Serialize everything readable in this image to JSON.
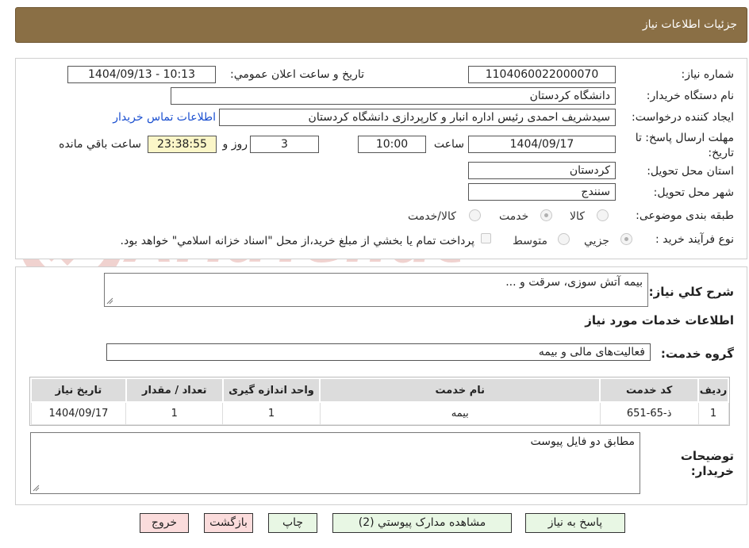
{
  "header": {
    "title": "جزئیات اطلاعات نیاز"
  },
  "form": {
    "need_number_label": "شماره نیاز:",
    "need_number": "1104060022000070",
    "announce_label": "تاریخ و ساعت اعلان عمومي:",
    "announce_value": "1404/09/13 - 10:13",
    "buyer_org_label": "نام دستگاه خريدار:",
    "buyer_org": "دانشگاه کردستان",
    "creator_label": "ايجاد کننده درخواست:",
    "creator": "سيدشريف احمدی رئيس اداره انبار و کارپردازی دانشگاه کردستان",
    "contact_link": "اطلاعات تماس خريدار",
    "deadline_label": "مهلت ارسال پاسخ: تا تاریخ:",
    "deadline_date": "1404/09/17",
    "time_label": "ساعت",
    "deadline_time": "10:00",
    "days": "3",
    "days_label": "روز و",
    "remaining": "23:38:55",
    "remaining_label": "ساعت باقي مانده",
    "province_label": "استان محل تحويل:",
    "province": "کردستان",
    "city_label": "شهر محل تحويل:",
    "city": "سنندج",
    "category_label": "طبقه بندی موضوعی:",
    "category_options": [
      "کالا",
      "خدمت",
      "کالا/خدمت"
    ],
    "category_selected": "خدمت",
    "process_label": "نوع فرآيند خريد :",
    "process_options": [
      "جزيي",
      "متوسط"
    ],
    "process_selected": "جزيي",
    "payment_note": "پرداخت تمام يا بخشي از مبلغ خريد،از محل \"اسناد خزانه اسلامي\" خواهد بود."
  },
  "description": {
    "summary_label": "شرح کلي نياز:",
    "summary": "بیمه آتش سوزی، سرقت و ...",
    "services_title": "اطلاعات خدمات مورد نياز",
    "service_group_label": "گروه خدمت:",
    "service_group": "فعاليت‌های مالی و بيمه"
  },
  "table": {
    "headers": [
      "رديف",
      "کد خدمت",
      "نام خدمت",
      "واحد اندازه گيری",
      "تعداد / مقدار",
      "تاريخ نياز"
    ],
    "rows": [
      [
        "1",
        "ذ-65-651",
        "بیمه",
        "1",
        "1",
        "1404/09/17"
      ]
    ]
  },
  "buyer_notes": {
    "label": "توضيحات خريدار:",
    "text": "مطابق دو فایل پیوست"
  },
  "buttons": {
    "reply": "پاسخ به نياز",
    "attachments": "مشاهده مدارک پيوستي (2)",
    "print": "چاپ",
    "back": "بازگشت",
    "exit": "خروج"
  },
  "colors": {
    "header_bg": "#8a6f45",
    "link": "#1a4fd0",
    "green_button": "#e8f7e4",
    "red_button": "#fbdcdc",
    "remaining_bg": "#fbf6c8"
  }
}
